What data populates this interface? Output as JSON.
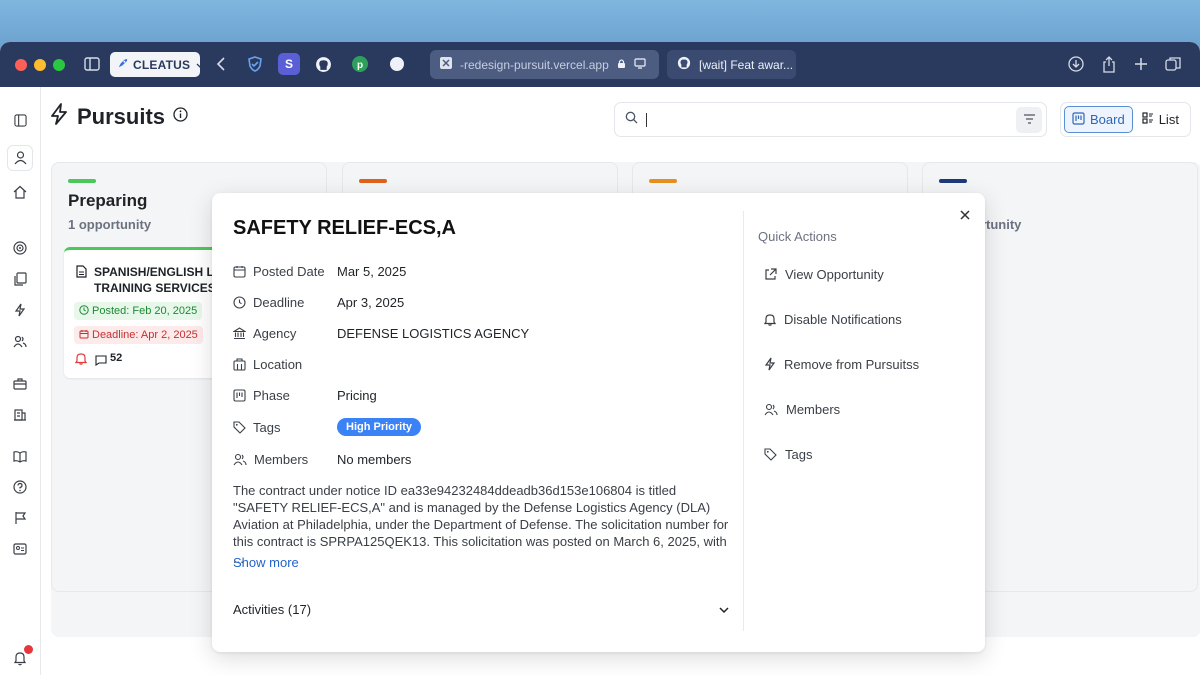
{
  "browser": {
    "profile_button": "CLEATUS",
    "tabs": [
      {
        "label": "-redesign-pursuit.vercel.app"
      },
      {
        "label": "[wait] Feat awar..."
      }
    ]
  },
  "page": {
    "title": "Pursuits",
    "search_value": "",
    "view_toggle": {
      "board": "Board",
      "list": "List",
      "active": "Board"
    }
  },
  "board": {
    "columns": [
      {
        "title": "Preparing",
        "count": "1 opportunity",
        "color": "#4cc75a"
      },
      {
        "title": "",
        "count": "",
        "color": "#e0611a"
      },
      {
        "title": "",
        "count": "",
        "color": "#e8901f"
      },
      {
        "title": "",
        "count": "ortunity",
        "color": "#1f3a7a"
      }
    ],
    "card": {
      "title": "SPANISH/ENGLISH L TRAINING SERVICES",
      "posted": "Posted: Feb 20, 2025",
      "deadline": "Deadline: Apr 2, 2025",
      "comments": "52"
    }
  },
  "modal": {
    "title": "SAFETY RELIEF-ECS,A",
    "fields": {
      "posted_label": "Posted Date",
      "posted_value": "Mar 5, 2025",
      "deadline_label": "Deadline",
      "deadline_value": "Apr 3, 2025",
      "agency_label": "Agency",
      "agency_value": "DEFENSE LOGISTICS AGENCY",
      "location_label": "Location",
      "location_value": "",
      "phase_label": "Phase",
      "phase_value": "Pricing",
      "tags_label": "Tags",
      "tags_value": "High Priority",
      "members_label": "Members",
      "members_value": "No members"
    },
    "description": "The contract under notice ID ea33e94232484ddeadb36d153e106804 is titled \"SAFETY RELIEF-ECS,A\" and is managed by the Defense Logistics Agency (DLA) Aviation at Philadelphia, under the Department of Defense. The solicitation number for this contract is SPRPA125QEK13. This solicitation was posted on March 6, 2025, with ...",
    "show_more": "Show more",
    "activities": "Activities (17)",
    "quick_actions": {
      "title": "Quick Actions",
      "view": "View Opportunity",
      "disable": "Disable Notifications",
      "remove": "Remove from Pursuitss",
      "members": "Members",
      "tags": "Tags"
    }
  },
  "colors": {
    "accent": "#3b82f6",
    "titlebar": "#2a3a5e",
    "link": "#2563c9"
  }
}
